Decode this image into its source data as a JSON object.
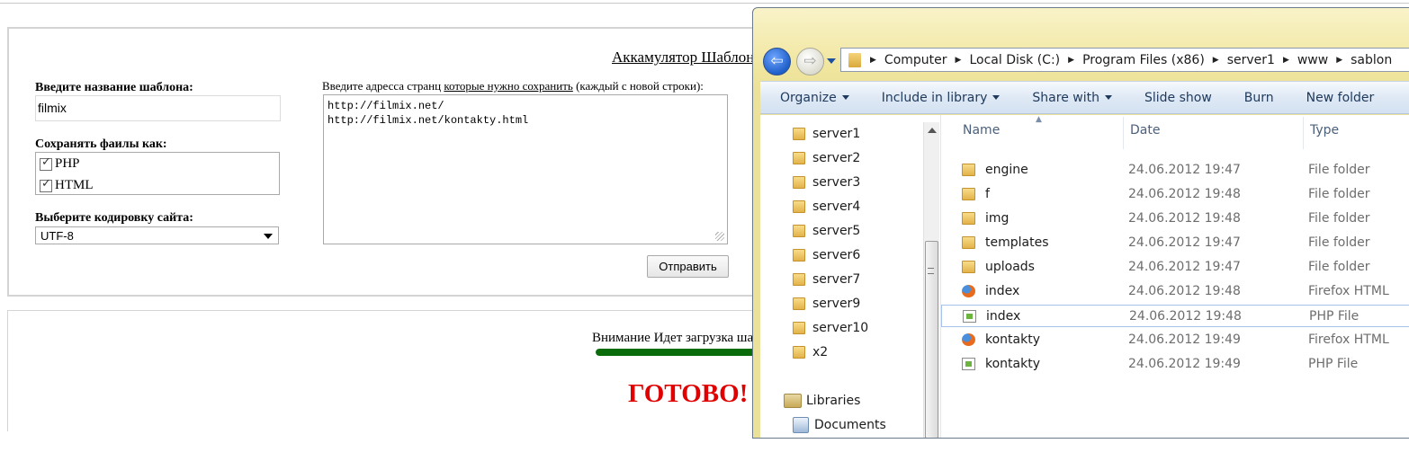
{
  "form": {
    "title": "Аккамулятор Шаблонов",
    "name_label": "Введите название шаблона:",
    "name_value": "filmix",
    "save_as_label": "Сохранять фаилы как:",
    "save_options": [
      "PHP",
      "HTML"
    ],
    "encoding_label": "Выберите кодировку сайта:",
    "encoding_value": "UTF-8",
    "urls_label_start": "Введите адресса странц ",
    "urls_label_underlined": "которые нужно сохранить",
    "urls_label_end": " (каждый с новой строки):",
    "urls_value": "http://filmix.net/\nhttp://filmix.net/kontakty.html",
    "submit_label": "Отправить",
    "attention_text": "Внимание Идет загрузка шаблона",
    "progress_fraction": 1.0,
    "done_text": "ГОТОВО!"
  },
  "explorer": {
    "nav_back_glyph": "⇦",
    "nav_fwd_glyph": "⇨",
    "breadcrumbs": [
      "Computer",
      "Local Disk (C:)",
      "Program Files (x86)",
      "server1",
      "www",
      "sablon"
    ],
    "commands": [
      "Organize",
      "Include in library",
      "Share with",
      "Slide show",
      "Burn",
      "New folder"
    ],
    "nav_items": [
      "server1",
      "server2",
      "server3",
      "server4",
      "server5",
      "server6",
      "server7",
      "server9",
      "server10",
      "x2"
    ],
    "libraries_label": "Libraries",
    "documents_label": "Documents",
    "columns": [
      "Name",
      "Date",
      "Type"
    ],
    "files": [
      {
        "icon": "folder",
        "name": "engine",
        "date": "24.06.2012 19:47",
        "type": "File folder"
      },
      {
        "icon": "folder",
        "name": "f",
        "date": "24.06.2012 19:48",
        "type": "File folder"
      },
      {
        "icon": "folder",
        "name": "img",
        "date": "24.06.2012 19:48",
        "type": "File folder"
      },
      {
        "icon": "folder",
        "name": "templates",
        "date": "24.06.2012 19:47",
        "type": "File folder"
      },
      {
        "icon": "folder",
        "name": "uploads",
        "date": "24.06.2012 19:47",
        "type": "File folder"
      },
      {
        "icon": "firefox-html",
        "name": "index",
        "date": "24.06.2012 19:48",
        "type": "Firefox HTML"
      },
      {
        "icon": "php",
        "name": "index",
        "date": "24.06.2012 19:48",
        "type": "PHP File"
      },
      {
        "icon": "firefox-html",
        "name": "kontakty",
        "date": "24.06.2012 19:49",
        "type": "Firefox HTML"
      },
      {
        "icon": "php",
        "name": "kontakty",
        "date": "24.06.2012 19:49",
        "type": "PHP File"
      }
    ],
    "selected_row": 6
  }
}
